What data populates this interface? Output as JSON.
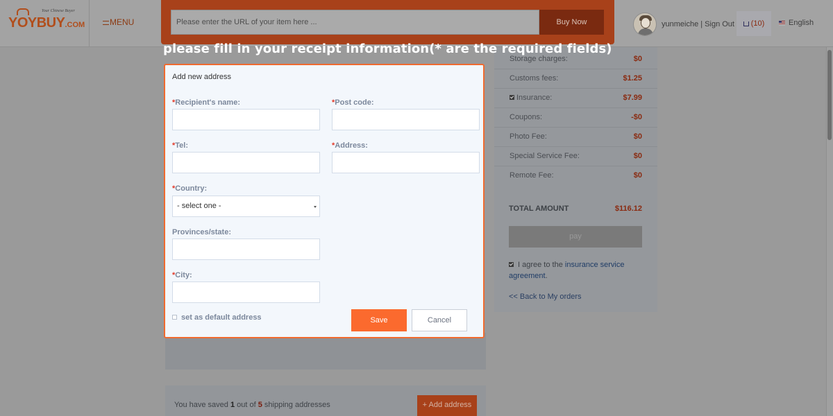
{
  "header": {
    "logo_text": "YOYBUY",
    "logo_suffix": ".COM",
    "logo_tagline": "Your Chinese Buyer",
    "menu_label": "MENU",
    "url_placeholder": "Please enter the URL of your item here ...",
    "buy_now_label": "Buy Now",
    "user_links": "yunmeiche | Sign Out",
    "cart_count": "(10)",
    "language": "English"
  },
  "modal": {
    "heading": "please fill in your receipt information(* are the required fields)",
    "title": "Add new address",
    "required_mark": "*",
    "fields": {
      "recipient_label": "Recipient's name:",
      "postcode_label": "Post code:",
      "tel_label": "Tel:",
      "address_label": "Address:",
      "country_label": "Country:",
      "country_value": "- select one -",
      "province_label": "Provinces/state:",
      "city_label": "City:"
    },
    "default_address_label": "set as default address",
    "save_label": "Save",
    "cancel_label": "Cancel"
  },
  "summary": {
    "fees": [
      {
        "label": "Storage charges:",
        "value": "$0"
      },
      {
        "label": "Customs fees:",
        "value": "$1.25"
      },
      {
        "label": "Insurance:",
        "value": "$7.99"
      },
      {
        "label": "Coupons:",
        "value": "-$0"
      },
      {
        "label": "Photo Fee:",
        "value": "$0"
      },
      {
        "label": "Special Service Fee:",
        "value": "$0"
      },
      {
        "label": "Remote Fee:",
        "value": "$0"
      }
    ],
    "total_label": "TOTAL AMOUNT",
    "total_value": "$116.12",
    "pay_label": "pay",
    "agree_prefix": "I agree to the",
    "agree_link": "insurance service agreement",
    "agree_suffix": ".",
    "back_label": "<< Back to My orders"
  },
  "addresses": {
    "saved_prefix": "You have saved",
    "saved_count": "1",
    "saved_middle": "out of",
    "saved_max": "5",
    "saved_suffix": "shipping addresses",
    "add_label": "+ Add address"
  },
  "colors": {
    "accent": "#fb6a2e",
    "modal_border": "#f06a2f",
    "required": "#e23a2a"
  }
}
